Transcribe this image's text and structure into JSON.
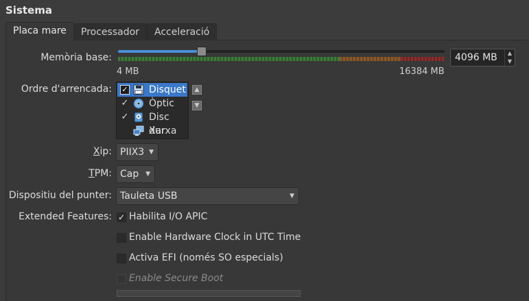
{
  "section_title": "Sistema",
  "tabs": [
    {
      "label": "Placa mare",
      "active": true
    },
    {
      "label": "Processador",
      "active": false
    },
    {
      "label": "Acceleració",
      "active": false
    }
  ],
  "memory": {
    "label": "Memòria base:",
    "min_label": "4 MB",
    "max_label": "16384 MB",
    "value_text": "4096 MB",
    "value_mb": 4096
  },
  "boot_order": {
    "label": "Ordre d'arrencada:",
    "items": [
      {
        "label": "Disquet",
        "checked": true,
        "selected": true,
        "icon": "floppy-icon"
      },
      {
        "label": "Òptic",
        "checked": true,
        "selected": false,
        "icon": "optical-disc-icon"
      },
      {
        "label": "Disc dur",
        "checked": true,
        "selected": false,
        "icon": "hard-disk-icon"
      },
      {
        "label": "Xarxa",
        "checked": false,
        "selected": false,
        "icon": "network-icon"
      }
    ]
  },
  "chipset": {
    "label": "Xip:",
    "value": "PIIX3"
  },
  "tpm": {
    "label": "TPM:",
    "value": "Cap"
  },
  "pointer": {
    "label": "Dispositiu del punter:",
    "value": "Tauleta USB"
  },
  "extended": {
    "label": "Extended Features:",
    "options": [
      {
        "label": "Habilita I/O APIC",
        "checked": true,
        "enabled": true
      },
      {
        "label": "Enable Hardware Clock in UTC Time",
        "checked": false,
        "enabled": true
      },
      {
        "label": "Activa EFI (només SO especials)",
        "checked": false,
        "enabled": true
      },
      {
        "label": "Enable Secure Boot",
        "checked": false,
        "enabled": false
      }
    ]
  },
  "colors": {
    "accent": "#3a78c9",
    "slider_fill": "#4a8fd6"
  }
}
